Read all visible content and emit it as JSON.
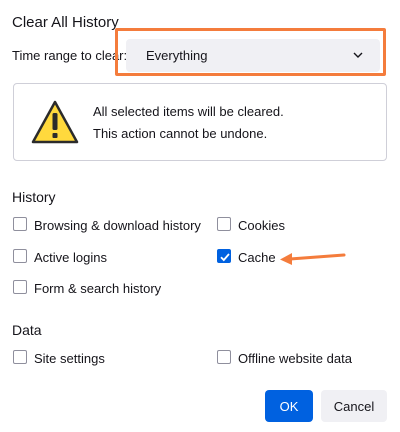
{
  "dialog": {
    "title": "Clear All History",
    "time_range": {
      "label": "Time range to clear:",
      "value": "Everything"
    },
    "warning": {
      "line1": "All selected items will be cleared.",
      "line2": "This action cannot be undone.",
      "icon": "warning-triangle-icon"
    },
    "history": {
      "heading": "History",
      "items": [
        {
          "label": "Browsing & download history",
          "checked": false
        },
        {
          "label": "Cookies",
          "checked": false
        },
        {
          "label": "Active logins",
          "checked": false
        },
        {
          "label": "Cache",
          "checked": true
        },
        {
          "label": "Form & search history",
          "checked": false
        }
      ]
    },
    "data": {
      "heading": "Data",
      "items": [
        {
          "label": "Site settings",
          "checked": false
        },
        {
          "label": "Offline website data",
          "checked": false
        }
      ]
    },
    "buttons": {
      "ok": "OK",
      "cancel": "Cancel"
    }
  },
  "colors": {
    "accent": "#0061e0",
    "annotation": "#f47c3c"
  }
}
